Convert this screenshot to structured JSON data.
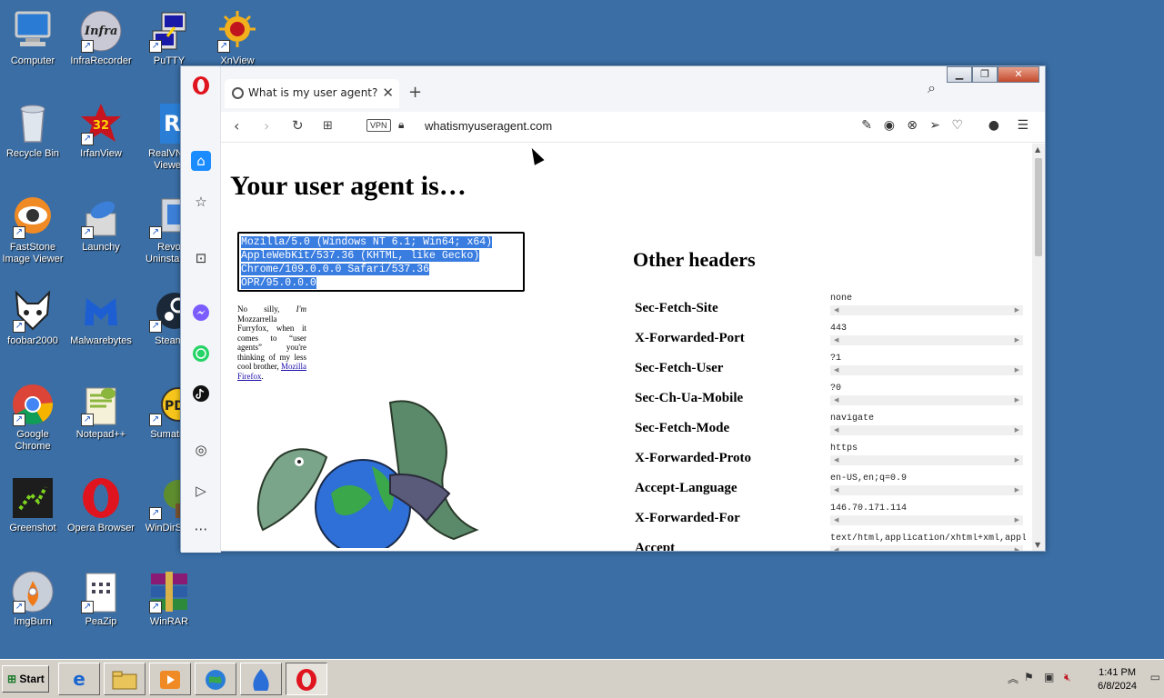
{
  "desktop": {
    "icons": [
      {
        "label": "Computer"
      },
      {
        "label": "InfraRecorder"
      },
      {
        "label": "PuTTY"
      },
      {
        "label": "XnView"
      },
      {
        "label": "Recycle Bin"
      },
      {
        "label": "IrfanView"
      },
      {
        "label": "RealVNC Viewer"
      },
      {
        "label": "FastStone Image Viewer"
      },
      {
        "label": "Launchy"
      },
      {
        "label": "Revo Uninstaller"
      },
      {
        "label": "foobar2000"
      },
      {
        "label": "Malwarebytes"
      },
      {
        "label": "Steam"
      },
      {
        "label": "Google Chrome"
      },
      {
        "label": "Notepad++"
      },
      {
        "label": "Sumatra"
      },
      {
        "label": "Greenshot"
      },
      {
        "label": "Opera Browser"
      },
      {
        "label": "WinDirStat"
      },
      {
        "label": "ImgBurn"
      },
      {
        "label": "PeaZip"
      },
      {
        "label": "WinRAR"
      }
    ],
    "irfanview_badge": "32"
  },
  "browser": {
    "tab_title": "What is my user agent?",
    "vpn_label": "VPN",
    "url": "whatismyuseragent.com"
  },
  "page": {
    "heading": "Your user agent is…",
    "user_agent_lines": [
      "Mozilla/5.0 (Windows NT 6.1; Win64; x64)",
      "AppleWebKit/537.36 (KHTML, like Gecko)",
      "Chrome/109.0.0.0 Safari/537.36",
      "OPR/95.0.0.0"
    ],
    "blurb_prefix": "No silly, ",
    "blurb_em": "I'm",
    "blurb_middle": " Mozzarrella Furryfox, when it comes to “user agents” you're thinking of my less cool brother, ",
    "blurb_link": "Mozilla Firefox",
    "blurb_end": ".",
    "other_headers_title": "Other headers",
    "headers": [
      {
        "name": "Sec-Fetch-Site",
        "value": "none"
      },
      {
        "name": "X-Forwarded-Port",
        "value": "443"
      },
      {
        "name": "Sec-Fetch-User",
        "value": "?1"
      },
      {
        "name": "Sec-Ch-Ua-Mobile",
        "value": "?0"
      },
      {
        "name": "Sec-Fetch-Mode",
        "value": "navigate"
      },
      {
        "name": "X-Forwarded-Proto",
        "value": "https"
      },
      {
        "name": "Accept-Language",
        "value": "en-US,en;q=0.9"
      },
      {
        "name": "X-Forwarded-For",
        "value": "146.70.171.114"
      },
      {
        "name": "Accept",
        "value": "text/html,application/xhtml+xml,appl"
      }
    ]
  },
  "taskbar": {
    "start_label": "Start",
    "time": "1:41 PM",
    "date": "6/8/2024"
  },
  "colors": {
    "desktop_bg": "#3a6ea5",
    "selection": "#3a7de0",
    "opera_red": "#e0141e"
  }
}
